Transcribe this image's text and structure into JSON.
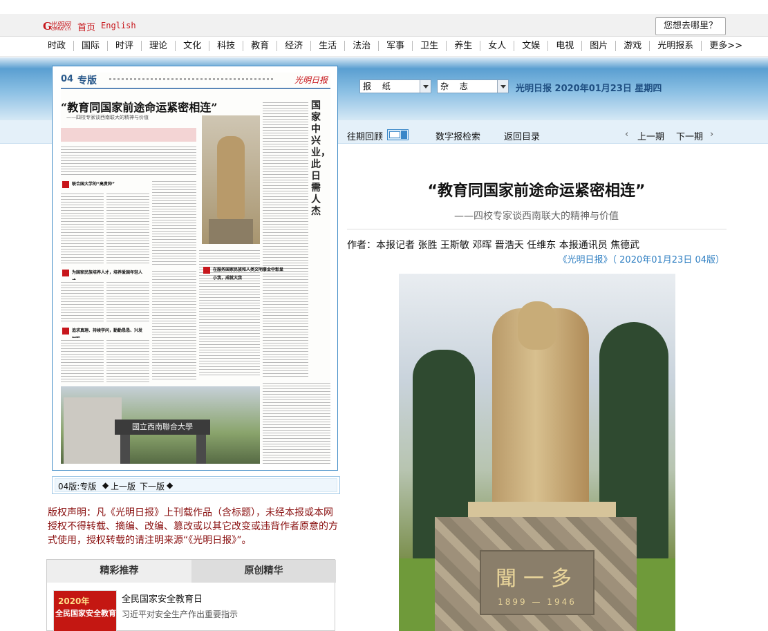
{
  "header": {
    "logo_text": "光明网",
    "logo_sub": "GMW.cn",
    "home": "首页",
    "english": "English",
    "search_button": "您想去哪里？"
  },
  "nav": [
    "时政",
    "国际",
    "时评",
    "理论",
    "文化",
    "科技",
    "教育",
    "经济",
    "生活",
    "法治",
    "军事",
    "卫生",
    "养生",
    "女人",
    "文娱",
    "电视",
    "图片",
    "游戏",
    "光明报系",
    "更多>>"
  ],
  "selectors": {
    "paper": "报 纸",
    "magazine": "杂 志"
  },
  "date_line": "光明日报  2020年01月23日  星期四",
  "toolbar": {
    "past_review": "往期回顾",
    "digital_search": "数字报检索",
    "back_to_index": "返回目录",
    "prev_issue": "上一期",
    "next_issue": "下一期"
  },
  "newspaper": {
    "page_no": "04",
    "page_name": "专版",
    "masthead": "光明日报",
    "headline": "“教育同国家前途命运紧密相连”",
    "subline": "——四校专家谈西南联大的精神与价值",
    "vertical_title": "国家中兴业，此日需人杰",
    "section_1": "联合国大学的“高贵种”",
    "section_2": "为国家民族培养人才，培养爱国年轻人才",
    "section_3": "追求真理、持续学问，勤勤恳恳、兴发时职",
    "section_4": "在服务国家民族和人类文明事业中彰显小我，成就大我",
    "gate_text": "國立西南聯合大學"
  },
  "pager": {
    "current": "04版:专版",
    "prev": "上一版",
    "next": "下一版"
  },
  "copyright": "版权声明：凡《光明日报》上刊载作品（含标题），未经本报或本网授权不得转载、摘编、改编、篡改或以其它改变或违背作者原意的方式使用，授权转载的请注明来源“《光明日报》”。",
  "tabs": {
    "featured": "精彩推荐",
    "original": "原创精华"
  },
  "recommend": {
    "thumb_year": "2020年",
    "thumb_text": "全民国家安全教育日",
    "title": "全民国家安全教育日",
    "subtitle": "习近平对安全生产作出重要指示"
  },
  "article": {
    "title": "“教育同国家前途命运紧密相连”",
    "subtitle": "——四校专家谈西南联大的精神与价值",
    "author": "作者：本报记者 张胜 王斯敏 邓晖 晋浩天 任维东 本报通讯员 焦德武",
    "source": "《光明日报》（ 2020年01月23日  04版）",
    "plaque_name": "聞一多",
    "plaque_years": "1899 — 1946"
  },
  "colors": {
    "brand_red": "#c7161b",
    "link_blue": "#2f7fc2",
    "banner_blue": "#5a9fd1"
  }
}
